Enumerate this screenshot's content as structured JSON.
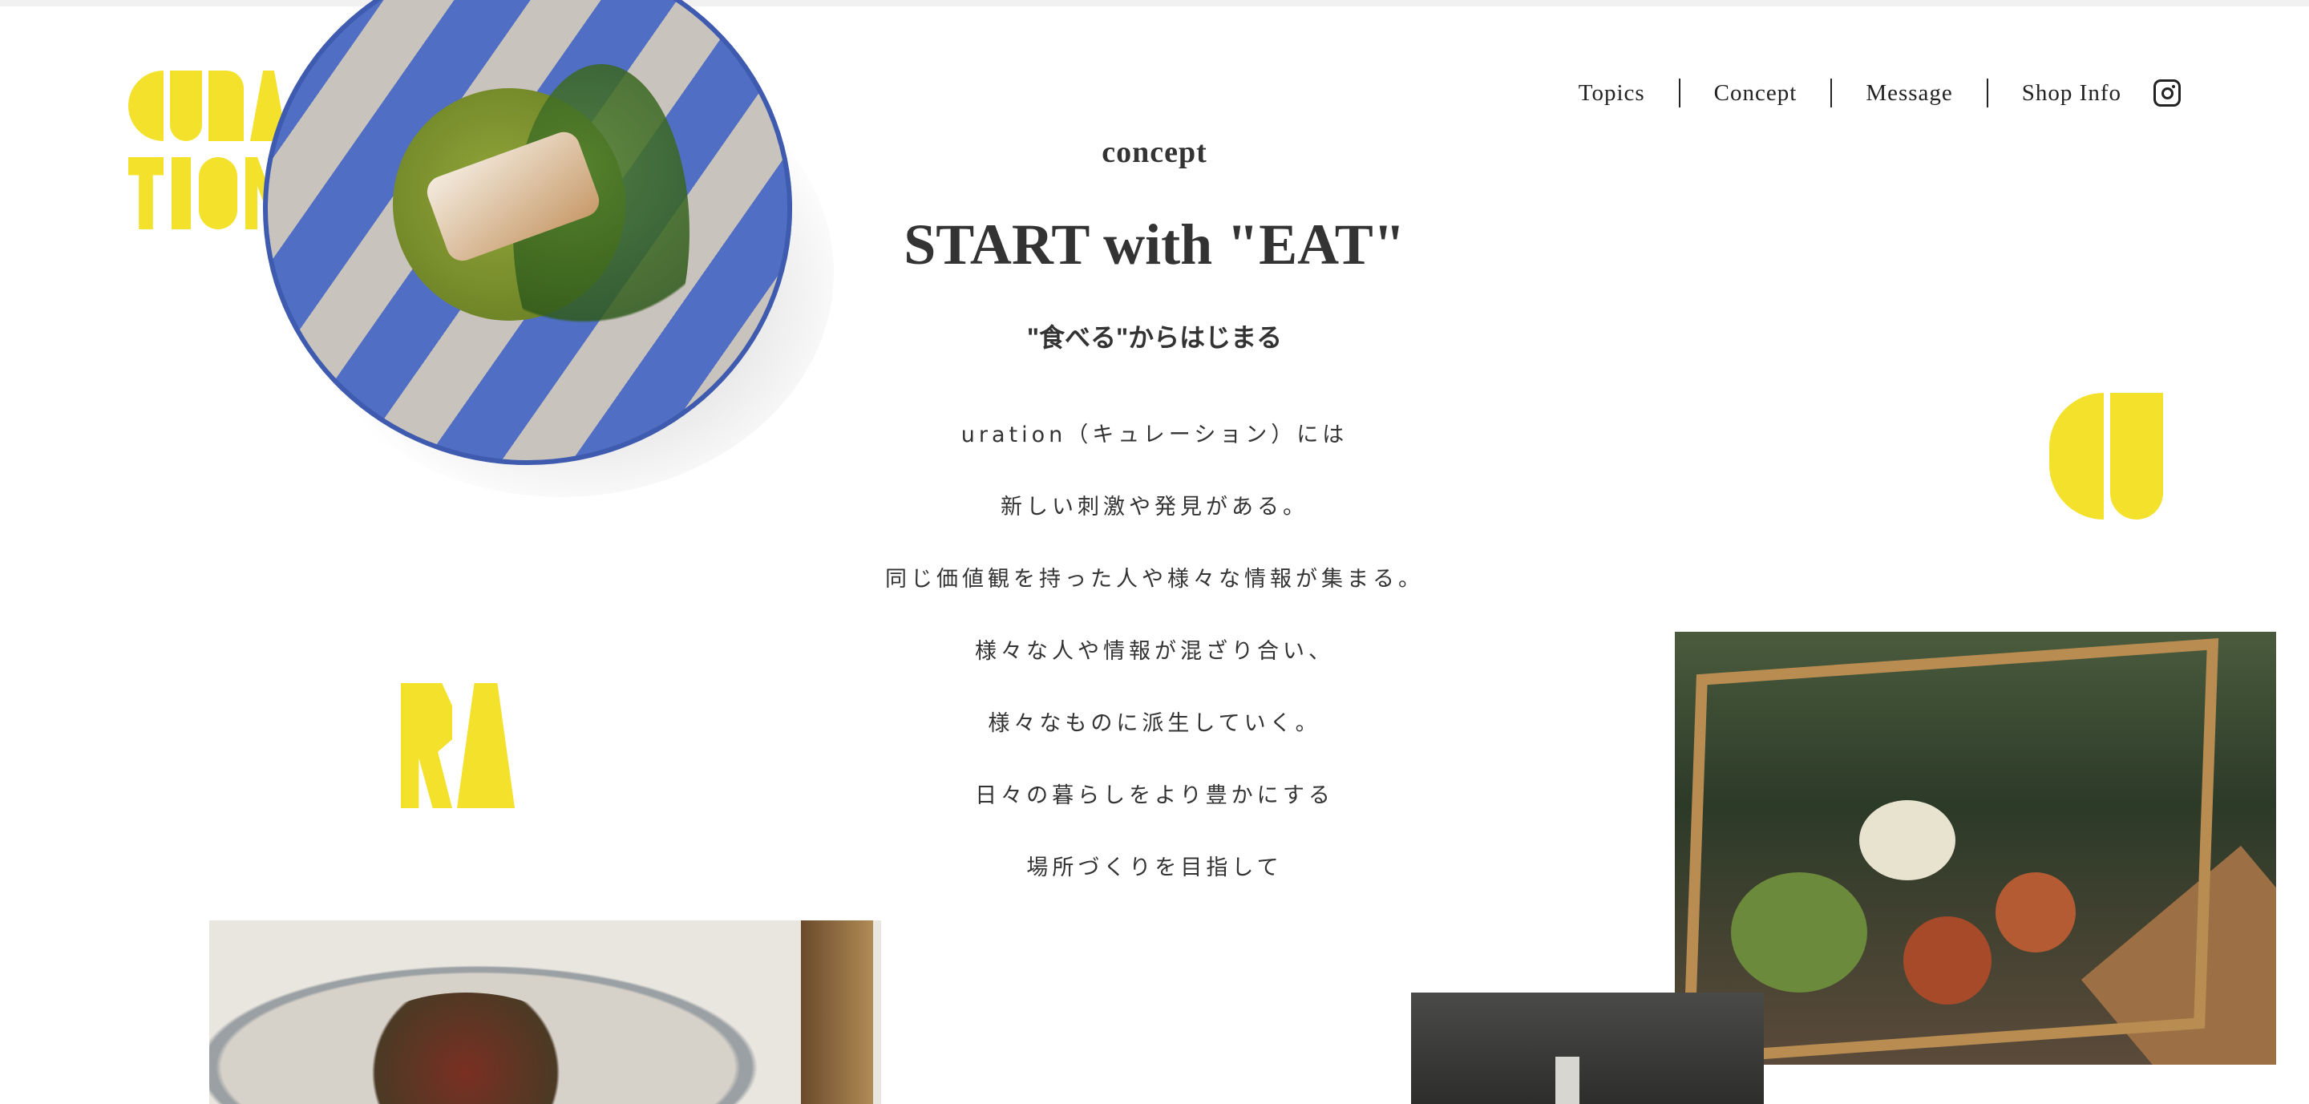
{
  "brand": {
    "logo_text": "CURATION",
    "accent_color": "#f4e12c"
  },
  "nav": {
    "items": [
      "Topics",
      "Concept",
      "Message",
      "Shop Info"
    ],
    "instagram_icon": "instagram-icon"
  },
  "concept": {
    "section_label": "concept",
    "headline": "START with \"EAT\"",
    "subhead": "\"食べる\"からはじまる",
    "lines": [
      "uration（キュレーション）には",
      "新しい刺激や発見がある。",
      "同じ価値観を持った人や様々な情報が集まる。",
      "様々な人や情報が混ざり合い、",
      "様々なものに派生していく。",
      "日々の暮らしをより豊かにする",
      "場所づくりを目指して"
    ]
  },
  "decor": {
    "left_letters": "RA",
    "right_letters": "CU"
  },
  "images": [
    "plate-fish-dish",
    "plated-meat-dish",
    "vegetable-display-case",
    "kitchen-photo"
  ]
}
